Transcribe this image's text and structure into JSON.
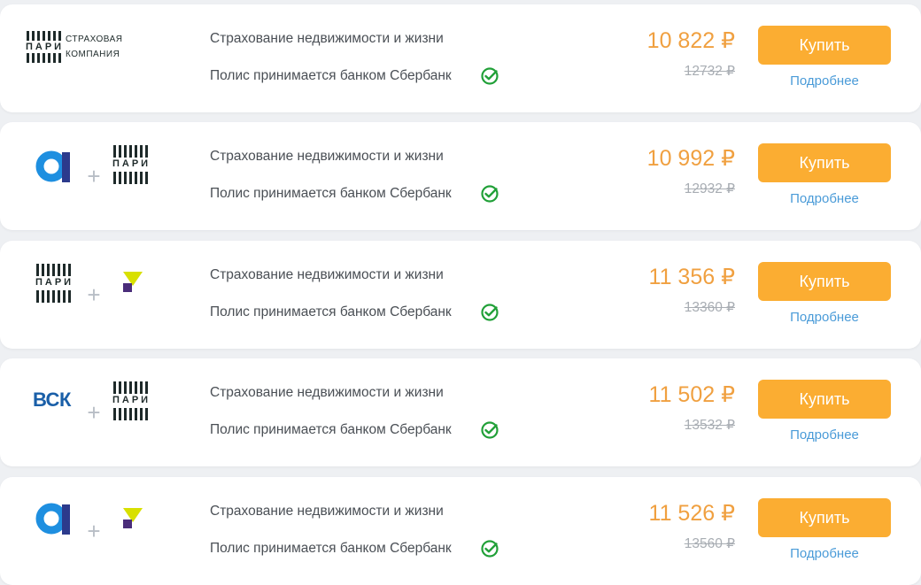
{
  "offers": [
    {
      "logos": [
        "pari-icon"
      ],
      "brand_lines": [
        "СТРАХОВАЯ",
        "КОМПАНИЯ"
      ],
      "brand_word": "ПАРИ",
      "title": "Страхование недвижимости и жизни",
      "policy_note": "Полис принимается банком Сбербанк",
      "price": "10 822 ₽",
      "old_price": "12732 ₽",
      "buy_label": "Купить",
      "details_label": "Подробнее"
    },
    {
      "logos": [
        "alfa-icon",
        "pari-icon"
      ],
      "plus": "+",
      "brand_word": "ПАРИ",
      "title": "Страхование недвижимости и жизни",
      "policy_note": "Полис принимается банком Сбербанк",
      "price": "10 992 ₽",
      "old_price": "12932 ₽",
      "buy_label": "Купить",
      "details_label": "Подробнее"
    },
    {
      "logos": [
        "pari-icon",
        "yellow-v-icon"
      ],
      "plus": "+",
      "brand_word": "ПАРИ",
      "title": "Страхование недвижимости и жизни",
      "policy_note": "Полис принимается банком Сбербанк",
      "price": "11 356 ₽",
      "old_price": "13360 ₽",
      "buy_label": "Купить",
      "details_label": "Подробнее"
    },
    {
      "logos": [
        "vsk-icon",
        "pari-icon"
      ],
      "plus": "+",
      "brand_word": "ПАРИ",
      "vsk_text": "ВСК",
      "title": "Страхование недвижимости и жизни",
      "policy_note": "Полис принимается банком Сбербанк",
      "price": "11 502 ₽",
      "old_price": "13532 ₽",
      "buy_label": "Купить",
      "details_label": "Подробнее"
    },
    {
      "logos": [
        "alfa-icon",
        "yellow-v-icon"
      ],
      "plus": "+",
      "title": "Страхование недвижимости и жизни",
      "policy_note": "Полис принимается банком Сбербанк",
      "price": "11 526 ₽",
      "old_price": "13560 ₽",
      "buy_label": "Купить",
      "details_label": "Подробнее"
    }
  ],
  "colors": {
    "price": "#f0a040",
    "button": "#fbad32",
    "link": "#4a9bd8",
    "check": "#21a038"
  }
}
